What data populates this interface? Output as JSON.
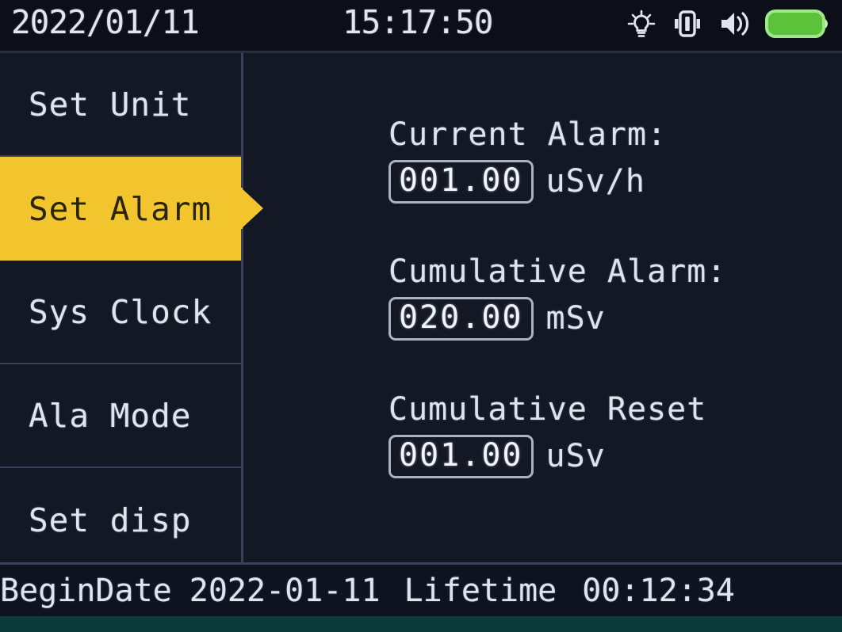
{
  "status_bar": {
    "date": "2022/01/11",
    "time": "15:17:50",
    "icons": [
      {
        "name": "backlight-icon",
        "label": "backlight"
      },
      {
        "name": "vibration-icon",
        "label": "vibration"
      },
      {
        "name": "sound-icon",
        "label": "sound"
      },
      {
        "name": "battery-icon",
        "label": "battery"
      }
    ],
    "battery_color": "#5cc23a"
  },
  "sidebar": {
    "selected_index": 1,
    "highlight_color": "#f2c52f",
    "items": [
      {
        "label": "Set Unit"
      },
      {
        "label": "Set Alarm"
      },
      {
        "label": "Sys Clock"
      },
      {
        "label": "Ala Mode"
      },
      {
        "label": "Set disp"
      }
    ]
  },
  "panel": {
    "fields": [
      {
        "title": "Current Alarm:",
        "value": "001.00",
        "unit": "uSv/h"
      },
      {
        "title": "Cumulative Alarm:",
        "value": "020.00",
        "unit": "mSv"
      },
      {
        "title": "Cumulative Reset",
        "value": "001.00",
        "unit": "uSv"
      }
    ]
  },
  "footer": {
    "begin_date_label": "BeginDate",
    "begin_date_value": "2022-01-11",
    "lifetime_label": "Lifetime",
    "lifetime_value": "00:12:34"
  }
}
